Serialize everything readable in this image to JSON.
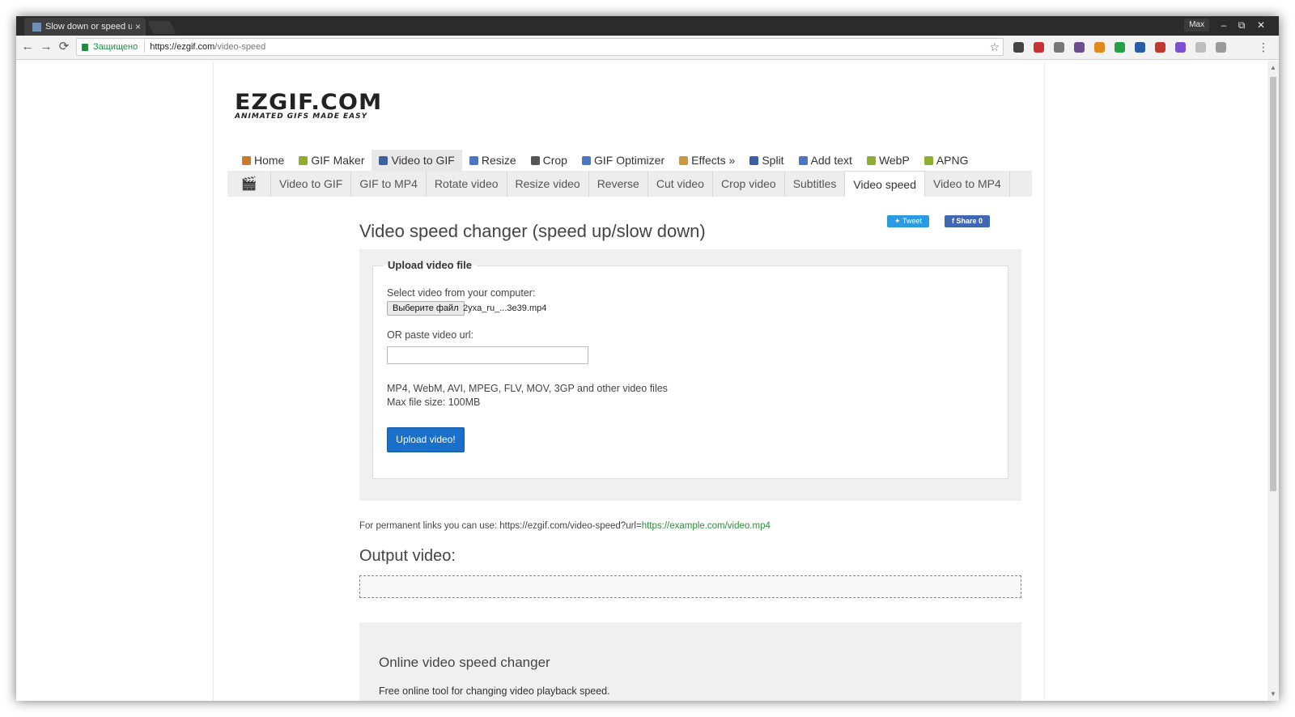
{
  "browser": {
    "tab_title": "Slow down or speed up",
    "tab_close": "×",
    "user": "Max",
    "window_buttons": [
      "–",
      "⧉",
      "✕"
    ],
    "secure_label": "Защищено",
    "url_host": "https://ezgif.com",
    "url_path": "/video-speed",
    "nav": {
      "back": "←",
      "forward": "→",
      "reload": "⟳"
    },
    "star": "☆",
    "menu": "⋮",
    "extension_colors": [
      "#444444",
      "#c83232",
      "#777777",
      "#6b4f8f",
      "#e08a1e",
      "#24a148",
      "#2a5ba8",
      "#c0392b",
      "#7d4fd1",
      "#bdbdbd",
      "#9a9a9a"
    ]
  },
  "logo": {
    "main": "EZGIF.COM",
    "tagline": "ANIMATED GIFS MADE EASY"
  },
  "main_nav": [
    {
      "label": "Home",
      "icon": "home-icon",
      "color": "#c97a2a",
      "active": false
    },
    {
      "label": "GIF Maker",
      "icon": "gif-maker-icon",
      "color": "#8fae2f",
      "active": false
    },
    {
      "label": "Video to GIF",
      "icon": "video-icon",
      "color": "#3c5f9e",
      "active": true
    },
    {
      "label": "Resize",
      "icon": "resize-icon",
      "color": "#4a76c2",
      "active": false
    },
    {
      "label": "Crop",
      "icon": "crop-icon",
      "color": "#555555",
      "active": false
    },
    {
      "label": "GIF Optimizer",
      "icon": "optimizer-icon",
      "color": "#4a76c2",
      "active": false
    },
    {
      "label": "Effects »",
      "icon": "effects-icon",
      "color": "#c99a3a",
      "active": false
    },
    {
      "label": "Split",
      "icon": "split-icon",
      "color": "#3c5f9e",
      "active": false
    },
    {
      "label": "Add text",
      "icon": "add-text-icon",
      "color": "#4a76c2",
      "active": false
    },
    {
      "label": "WebP",
      "icon": "webp-icon",
      "color": "#8fae2f",
      "active": false
    },
    {
      "label": "APNG",
      "icon": "apng-icon",
      "color": "#8fae2f",
      "active": false
    }
  ],
  "sub_nav": [
    {
      "label": "Video to GIF",
      "active": false
    },
    {
      "label": "GIF to MP4",
      "active": false
    },
    {
      "label": "Rotate video",
      "active": false
    },
    {
      "label": "Resize video",
      "active": false
    },
    {
      "label": "Reverse",
      "active": false
    },
    {
      "label": "Cut video",
      "active": false
    },
    {
      "label": "Crop video",
      "active": false
    },
    {
      "label": "Subtitles",
      "active": false
    },
    {
      "label": "Video speed",
      "active": true
    },
    {
      "label": "Video to MP4",
      "active": false
    }
  ],
  "page_title": "Video speed changer (speed up/slow down)",
  "social": {
    "tweet": "Tweet",
    "share": "Share 0"
  },
  "upload": {
    "legend": "Upload video file",
    "select_label": "Select video from your computer:",
    "file_button": "Выберите файл",
    "file_name": "2yxa_ru_...3e39.mp4",
    "url_label": "OR paste video url:",
    "url_value": "",
    "formats": "MP4, WebM, AVI, MPEG, FLV, MOV, 3GP and other video files",
    "max_size": "Max file size: 100MB",
    "submit": "Upload video!"
  },
  "permalink": {
    "prefix": "For permanent links you can use: https://ezgif.com/video-speed?url=",
    "example": "https://example.com/video.mp4"
  },
  "output_title": "Output video:",
  "info": {
    "title": "Online video speed changer",
    "text": "Free online tool for changing video playback speed."
  }
}
